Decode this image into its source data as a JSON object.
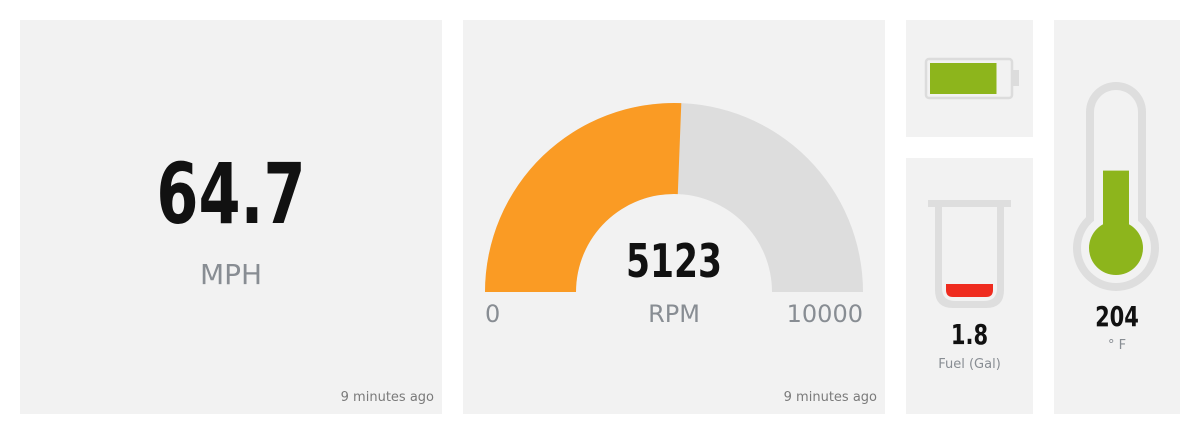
{
  "speed": {
    "value": "64.7",
    "unit": "MPH",
    "updated": "9 minutes ago"
  },
  "rpm": {
    "value": "5123",
    "unit": "RPM",
    "min_label": "0",
    "max_label": "10000",
    "min": 0,
    "max": 10000,
    "level": 5123,
    "updated": "9 minutes ago",
    "fill_color": "#fa9b24",
    "track_color": "#dddddd"
  },
  "battery": {
    "level_fraction": 0.95,
    "fill_color": "#8db51c",
    "icon": "battery-icon"
  },
  "fuel": {
    "value": "1.8",
    "unit": "Fuel (Gal)",
    "level_fraction": 0.16,
    "fill_color": "#ef2c1f",
    "icon": "fuel-beaker-icon"
  },
  "temperature": {
    "value": "204",
    "unit": "° F",
    "level_fraction": 0.45,
    "fill_color": "#8db51c",
    "icon": "thermometer-icon"
  }
}
